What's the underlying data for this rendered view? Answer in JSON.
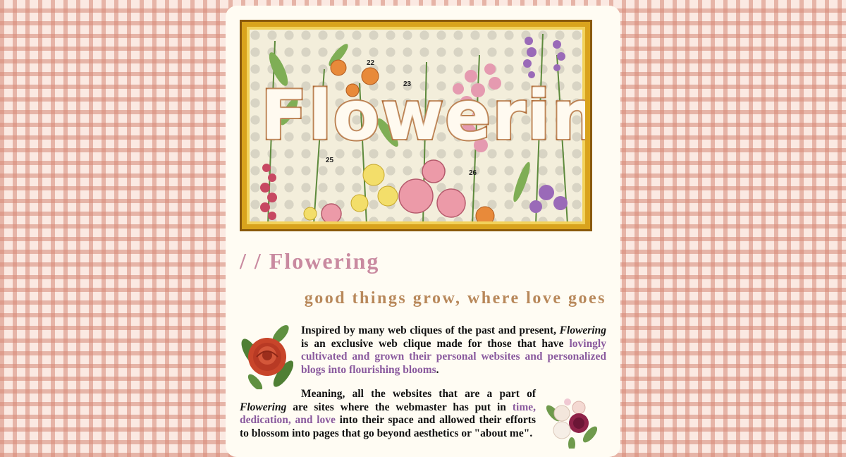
{
  "banner": {
    "title": "Flowering",
    "numbers": [
      "22",
      "23",
      "25",
      "26"
    ]
  },
  "page_title": "/ / Flowering",
  "tagline": "good things grow, where love goes",
  "intro": {
    "p1_a": "Inspired by many web cliques of the past and present, ",
    "p1_em": "Flowering",
    "p1_b": " is an exclusive web clique made for those that have ",
    "p1_highlight": "lovingly cultivated and grown their personal websites and personalized blogs into flourishing blooms",
    "p1_end": ".",
    "p2_a": "Meaning, all the websites that are a part of ",
    "p2_em": "Flowering",
    "p2_b": " are sites where the webmaster has put in ",
    "p2_highlight": "time, dedication, and love",
    "p2_c": " into their space and allowed their efforts to blossom into pages that go beyond aesthetics or \"about me\"."
  },
  "colors": {
    "page_title": "#c98aa0",
    "tagline": "#b8885a",
    "highlight": "#8a5a9e",
    "card": "#fffcf3",
    "frame": "#d9a31d"
  },
  "icons": {
    "rose": "red-rose-icon",
    "bouquet": "rose-bouquet-icon"
  }
}
